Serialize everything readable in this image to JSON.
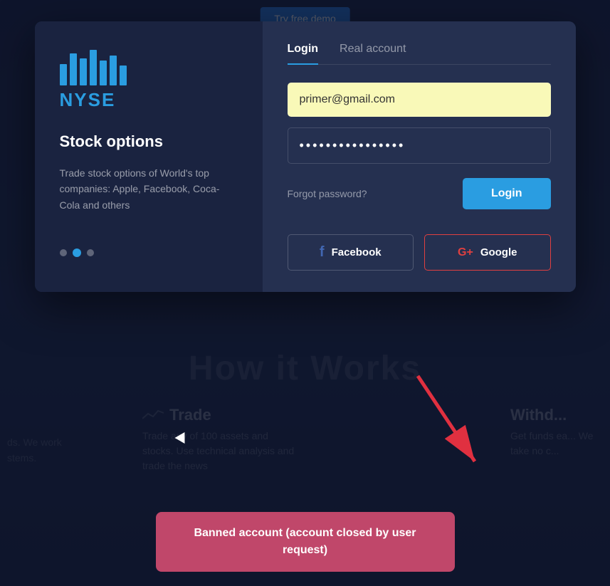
{
  "background": {
    "try_demo_label": "Try free demo"
  },
  "how_it_works": {
    "title": "How it Works"
  },
  "trade_section": {
    "title": "Trade",
    "description": "Trade any of 100 assets and stocks. Use technical analysis and trade the news"
  },
  "withdraw_section": {
    "title": "Withd...",
    "description": "Get funds ea... We take no c..."
  },
  "left_side_text": {
    "line1": "ds. We work",
    "line2": "stems."
  },
  "left_panel": {
    "logo_text": "NYSE",
    "title": "Stock options",
    "description": "Trade stock options of World's top companies: Apple, Facebook, Coca-Cola and others"
  },
  "tabs": {
    "login_label": "Login",
    "real_account_label": "Real account"
  },
  "form": {
    "email_value": "primer@gmail.com",
    "email_placeholder": "primer@gmail.com",
    "password_value": "················",
    "forgot_password_label": "Forgot password?",
    "login_button_label": "Login"
  },
  "social": {
    "facebook_label": "Facebook",
    "google_label": "Google"
  },
  "banner": {
    "text": "Banned account (account closed by user request)"
  },
  "colors": {
    "accent_blue": "#2a9de1",
    "background_dark": "#1a2340",
    "panel_dark": "#253050",
    "banned_bg": "#c0476a",
    "google_border": "#e04040"
  }
}
